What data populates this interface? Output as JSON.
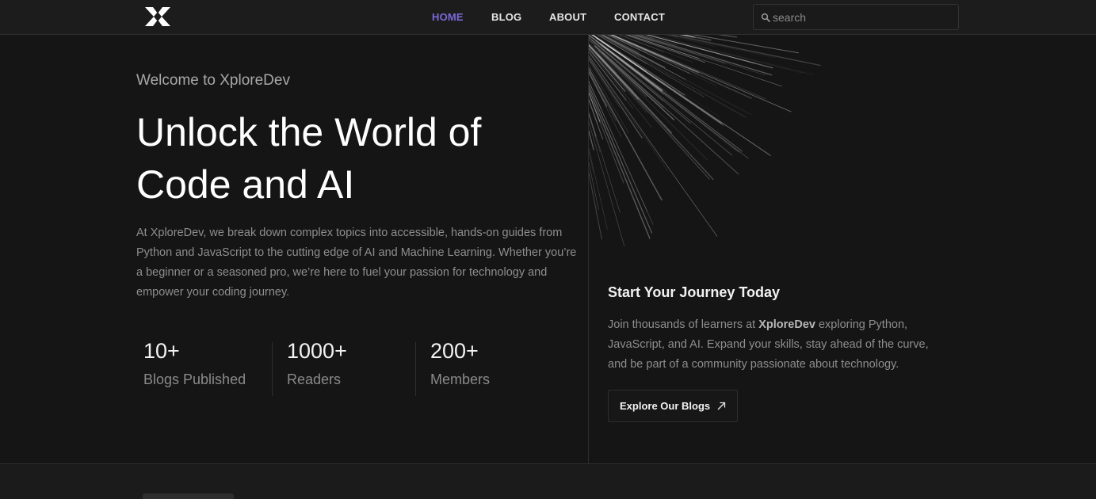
{
  "nav": {
    "links": [
      "HOME",
      "BLOG",
      "ABOUT",
      "CONTACT"
    ],
    "active": "HOME",
    "active_color": "#7a6ad8",
    "search_placeholder": "search",
    "logo_icon": "x-logo-icon"
  },
  "hero": {
    "welcome": "Welcome to XploreDev",
    "headline_line1": "Unlock the World of",
    "headline_line2": "Code and AI",
    "description": "At XploreDev, we break down complex topics into accessible, hands-on guides from Python and JavaScript to the cutting edge of AI and Machine Learning. Whether you’re a beginner or a seasoned pro, we’re here to fuel your passion for technology and empower your coding journey.",
    "stats": [
      {
        "value": "10+",
        "label": "Blogs Published"
      },
      {
        "value": "1000+",
        "label": "Readers"
      },
      {
        "value": "200+",
        "label": "Members"
      }
    ]
  },
  "card": {
    "title": "Start Your Journey Today",
    "text_before": "Join thousands of learners at ",
    "text_bold": "XploreDev",
    "text_after": " exploring Python, JavaScript, and AI. Expand your skills, stay ahead of the curve, and be part of a community passionate about technology.",
    "button_label": "Explore Our Blogs",
    "button_icon": "arrow-up-right-icon"
  },
  "colors": {
    "background": "#151515",
    "navbar": "#1c1c1c",
    "border": "#2e2e2e",
    "muted_text": "#8e8e8e"
  }
}
